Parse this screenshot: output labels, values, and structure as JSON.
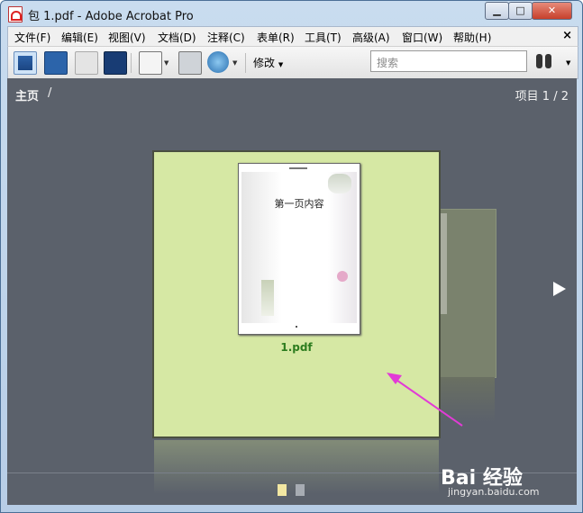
{
  "window": {
    "title": "包 1.pdf - Adobe Acrobat Pro",
    "min": "▁",
    "max": "□",
    "close": "✕"
  },
  "menu": {
    "items": [
      "文件(F)",
      "编辑(E)",
      "视图(V)",
      "文档(D)",
      "注释(C)",
      "表单(R)",
      "工具(T)",
      "高级(A)",
      "窗口(W)",
      "帮助(H)"
    ],
    "close": "×"
  },
  "toolbar": {
    "edit_label": "修改",
    "search_placeholder": "搜索"
  },
  "main": {
    "breadcrumb": "主页",
    "breadcrumb_sep": "/",
    "item_count": "项目 1 / 2",
    "card": {
      "thumb_text": "第一页内容",
      "file_name": "1.pdf"
    }
  },
  "watermark": {
    "main": "Bai 经验",
    "sub": "jingyan.baidu.com"
  },
  "colors": {
    "accent": "#2c7c1e",
    "card_bg": "#d6e8a4",
    "panel_bg": "#5b616b",
    "arrow": "#e23bd6"
  }
}
